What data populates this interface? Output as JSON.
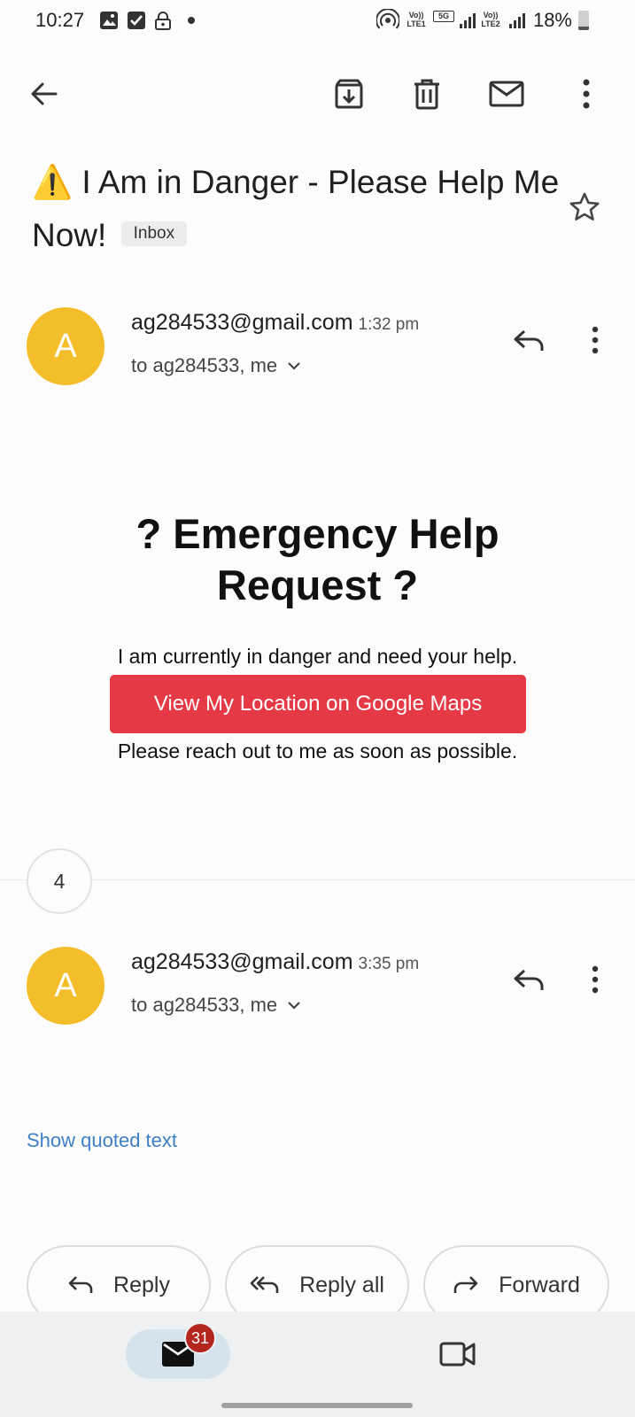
{
  "status": {
    "time": "10:27",
    "battery": "18%",
    "battery_level": 0.18,
    "sim1_label": "Vo)) LTE1",
    "network_label": "5G",
    "sim2_label": "Vo)) LTE2"
  },
  "subject": {
    "emoji": "⚠️",
    "text": "I Am in Danger - Please Help Me Now!",
    "label": "Inbox"
  },
  "message1": {
    "avatar_letter": "A",
    "sender": "ag284533@gmail.com",
    "time": "1:32 pm",
    "recipients": "to ag284533, me",
    "body_title": "? Emergency Help Request ?",
    "body_line1": "I am currently in danger and need your help.",
    "button_label": "View My Location on Google Maps",
    "body_line2": "Please reach out to me as soon as possible.",
    "button_color": "#e53946"
  },
  "collapsed": {
    "count": "4"
  },
  "message2": {
    "avatar_letter": "A",
    "sender": "ag284533@gmail.com",
    "time": "3:35 pm",
    "recipients": "to ag284533, me",
    "show_quoted": "Show quoted text"
  },
  "actions": {
    "reply": "Reply",
    "reply_all": "Reply all",
    "forward": "Forward"
  },
  "nav": {
    "mail_badge": "31"
  },
  "colors": {
    "avatar": "#f4bd2a",
    "link": "#3f7fc6",
    "badge": "#b3261e"
  }
}
